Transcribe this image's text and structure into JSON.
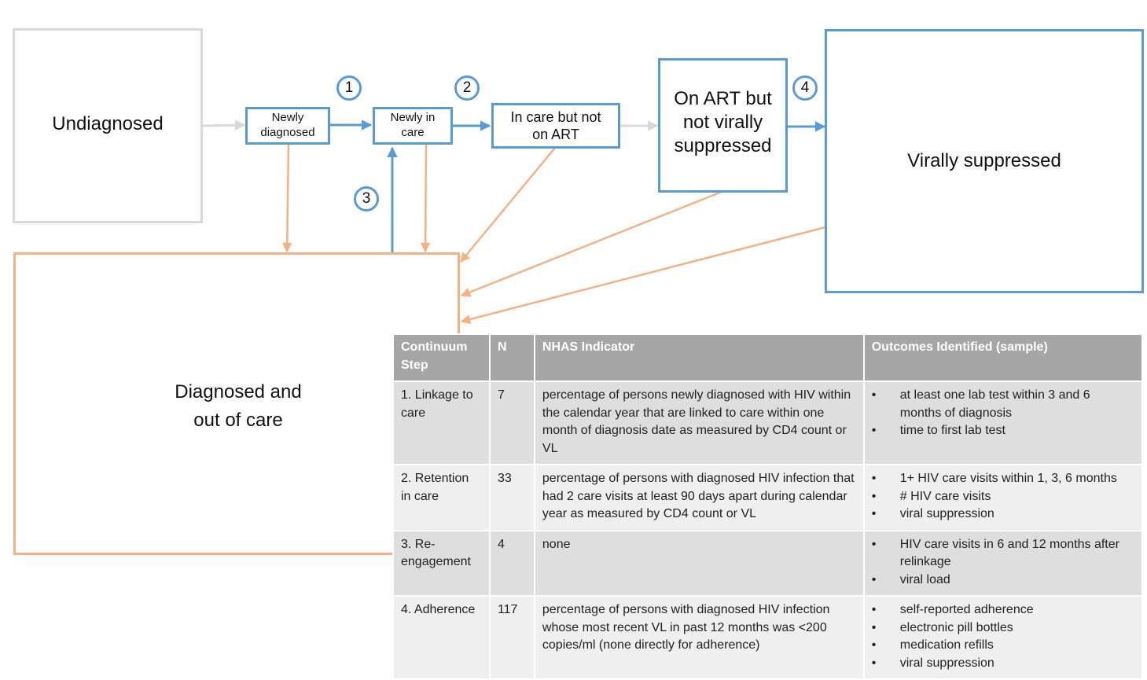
{
  "colors": {
    "blue": "#5b9bd5",
    "orange": "#f4b183",
    "grey": "#d9d9d9",
    "table_header": "#a6a6a6",
    "row_dark": "#dedede",
    "row_light": "#efefef"
  },
  "nodes": {
    "undiagnosed": "Undiagnosed",
    "newly_diagnosed": [
      "Newly",
      "diagnosed"
    ],
    "newly_in_care": [
      "Newly in",
      "care"
    ],
    "in_care_not_art": [
      "In care but not",
      "on ART"
    ],
    "on_art_not_suppressed": [
      "On ART but",
      "not virally",
      "suppressed"
    ],
    "virally_suppressed": "Virally suppressed",
    "diagnosed_out_of_care": [
      "Diagnosed and",
      "out of care"
    ]
  },
  "step_markers": [
    "1",
    "2",
    "3",
    "4"
  ],
  "table": {
    "headers": [
      "Continuum Step",
      "N",
      "NHAS Indicator",
      "Outcomes Identified (sample)"
    ],
    "rows": [
      {
        "step": "1. Linkage to care",
        "n": "7",
        "indicator": "percentage of persons newly diagnosed with HIV within the calendar year that are linked to care within one month of diagnosis date as measured by CD4 count or VL",
        "outcomes": [
          "at least one lab test within 3 and 6 months of diagnosis",
          "time to first lab test"
        ]
      },
      {
        "step": "2. Retention in care",
        "n": "33",
        "indicator": "percentage of persons with diagnosed HIV infection that had 2 care visits at least 90 days apart during calendar year as measured by CD4 count or VL",
        "outcomes": [
          "1+ HIV care visits within 1, 3, 6 months",
          "# HIV care visits",
          "viral suppression"
        ]
      },
      {
        "step": "3. Re-engagement",
        "n": "4",
        "indicator": "none",
        "outcomes": [
          "HIV care visits in 6 and 12 months after relinkage",
          "viral load"
        ]
      },
      {
        "step": "4. Adherence",
        "n": "117",
        "indicator": "percentage of persons with diagnosed HIV infection whose most recent VL in past 12 months was <200 copies/ml (none directly for adherence)",
        "outcomes": [
          "self-reported adherence",
          "electronic pill bottles",
          "medication refills",
          "viral suppression"
        ]
      }
    ]
  }
}
